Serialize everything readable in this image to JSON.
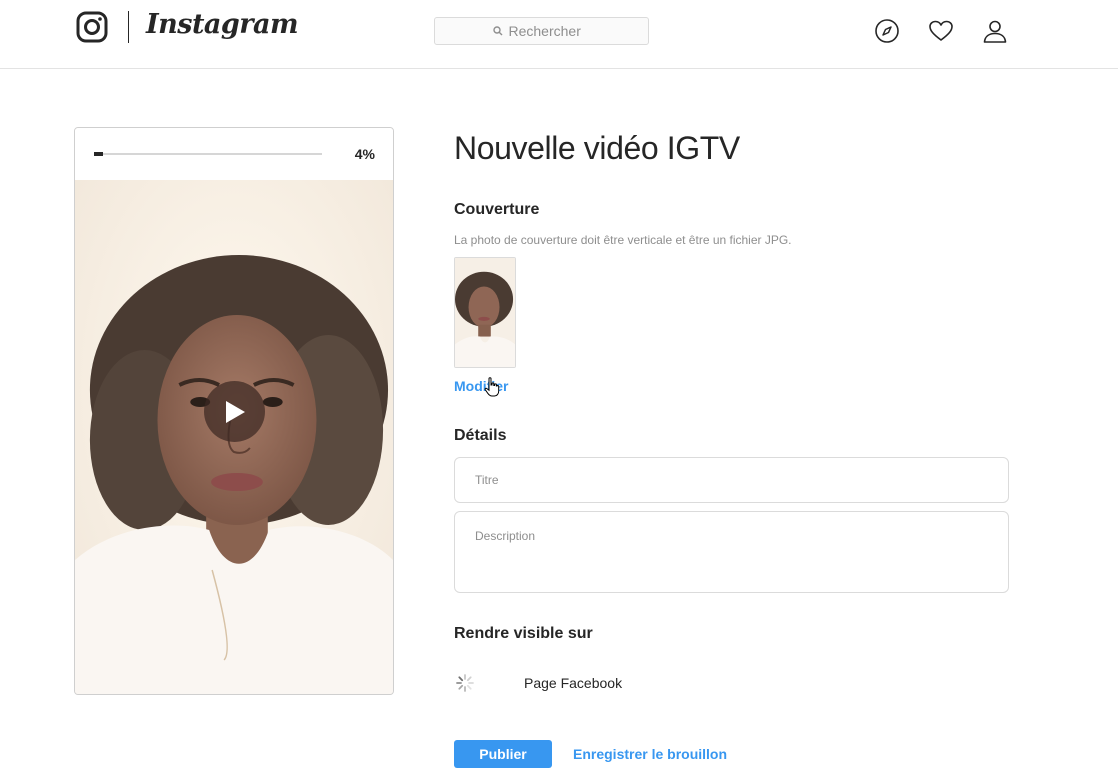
{
  "header": {
    "brand": "Instagram",
    "search_placeholder": "Rechercher"
  },
  "preview": {
    "upload_progress_label": "4%",
    "upload_progress_fraction": 0.04
  },
  "form": {
    "title": "Nouvelle vidéo IGTV",
    "cover": {
      "label": "Couverture",
      "hint": "La photo de couverture doit être verticale et être un fichier JPG.",
      "modify_link": "Modifier"
    },
    "details": {
      "label": "Détails",
      "title_placeholder": "Titre",
      "description_placeholder": "Description"
    },
    "visibility": {
      "label": "Rendre visible sur",
      "facebook_page_label": "Page Facebook"
    },
    "actions": {
      "publish": "Publier",
      "save_draft": "Enregistrer le brouillon"
    }
  },
  "icons": {
    "logo": "instagram-glyph-icon",
    "search": "search-icon",
    "explore": "compass-icon",
    "activity": "heart-icon",
    "profile": "user-icon",
    "play": "play-icon",
    "loading": "spinner-icon",
    "cursor": "hand-pointer-icon"
  },
  "colors": {
    "accent": "#3897f0",
    "text": "#262626",
    "muted": "#8e8e8e",
    "border": "#dbdbdb"
  }
}
